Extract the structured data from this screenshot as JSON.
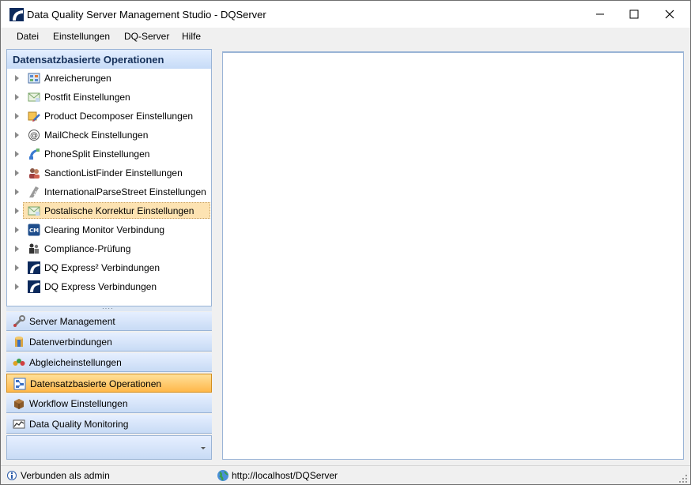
{
  "window": {
    "title": "Data Quality Server Management Studio - DQServer"
  },
  "menu": [
    "Datei",
    "Einstellungen",
    "DQ-Server",
    "Hilfe"
  ],
  "left_panel": {
    "header": "Datensatzbasierte Operationen",
    "tree_items": [
      {
        "label": "Anreicherungen",
        "icon": "grid-icon"
      },
      {
        "label": "Postfit Einstellungen",
        "icon": "envelope-icon"
      },
      {
        "label": "Product Decomposer Einstellungen",
        "icon": "box-pencil-icon"
      },
      {
        "label": "MailCheck Einstellungen",
        "icon": "at-sign-icon"
      },
      {
        "label": "PhoneSplit Einstellungen",
        "icon": "phone-icon"
      },
      {
        "label": "SanctionListFinder Einstellungen",
        "icon": "people-icon"
      },
      {
        "label": "InternationalParseStreet Einstellungen",
        "icon": "road-icon"
      },
      {
        "label": "Postalische Korrektur Einstellungen",
        "icon": "envelope-icon",
        "selected": true
      },
      {
        "label": "Clearing Monitor Verbindung",
        "icon": "cm-icon"
      },
      {
        "label": "Compliance-Prüfung",
        "icon": "user-check-icon"
      },
      {
        "label": "DQ Express² Verbindungen",
        "icon": "dq-logo-icon"
      },
      {
        "label": "DQ Express Verbindungen",
        "icon": "dq-logo-icon"
      }
    ],
    "nav_buttons": [
      {
        "label": "Server Management",
        "icon": "wrench-icon"
      },
      {
        "label": "Datenverbindungen",
        "icon": "database-icon"
      },
      {
        "label": "Abgleicheinstellungen",
        "icon": "colored-dots-icon"
      },
      {
        "label": "Datensatzbasierte Operationen",
        "icon": "flowchart-icon",
        "active": true
      },
      {
        "label": "Workflow Einstellungen",
        "icon": "cube-icon"
      },
      {
        "label": "Data Quality Monitoring",
        "icon": "chart-icon"
      }
    ]
  },
  "status": {
    "user": "Verbunden als admin",
    "url": "http://localhost/DQServer"
  },
  "colors": {
    "accent_selected": "#fde3b2",
    "nav_active": "#ffb84a",
    "panel_border": "#9ab4d6"
  }
}
